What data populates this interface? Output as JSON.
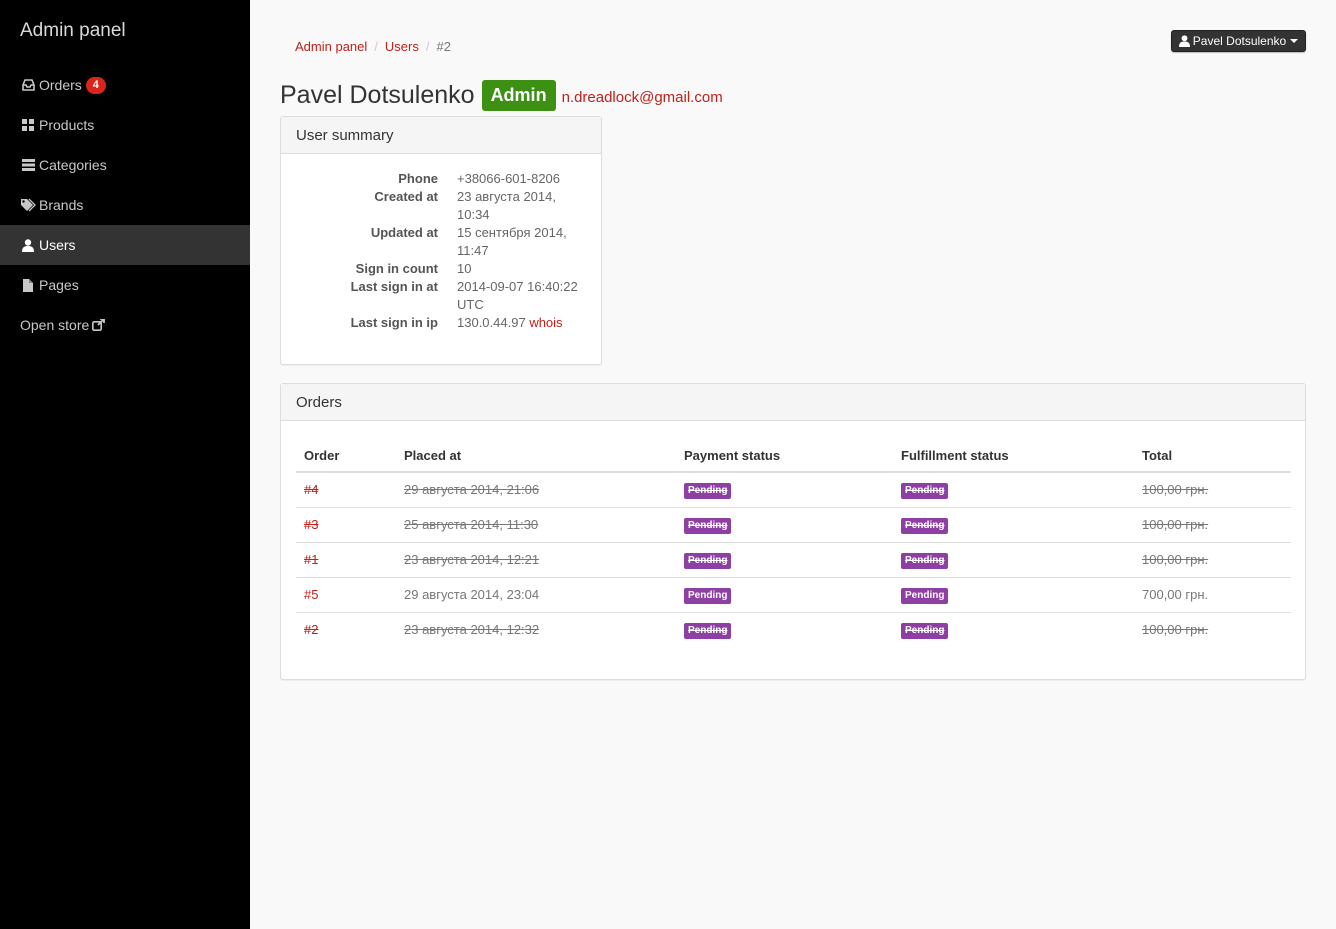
{
  "sidebar": {
    "brand": "Admin panel",
    "items": [
      {
        "label": "Orders",
        "icon": "inbox-icon",
        "badge": "4"
      },
      {
        "label": "Products",
        "icon": "grid-icon"
      },
      {
        "label": "Categories",
        "icon": "list-icon"
      },
      {
        "label": "Brands",
        "icon": "tags-icon"
      },
      {
        "label": "Users",
        "icon": "user-icon",
        "active": true
      },
      {
        "label": "Pages",
        "icon": "file-icon"
      },
      {
        "label": "Open store",
        "icon": "external-link-icon"
      }
    ]
  },
  "breadcrumb": {
    "items": [
      "Admin panel",
      "Users",
      "#2"
    ],
    "separator": "/"
  },
  "user_menu": {
    "label": "Pavel Dotsulenko",
    "icon": "user-icon"
  },
  "user": {
    "name": "Pavel Dotsulenko",
    "role": "Admin",
    "email": "n.dreadlock@gmail.com"
  },
  "summary": {
    "title": "User summary",
    "fields": [
      {
        "label": "Phone",
        "value": "+38066-601-8206"
      },
      {
        "label": "Created at",
        "value": "23 августа 2014, 10:34"
      },
      {
        "label": "Updated at",
        "value": "15 сентября 2014, 11:47"
      },
      {
        "label": "Sign in count",
        "value": "10"
      },
      {
        "label": "Last sign in at",
        "value": "2014-09-07 16:40:22 UTC"
      },
      {
        "label": "Last sign in ip",
        "value": "130.0.44.97",
        "link": "whois"
      }
    ]
  },
  "orders": {
    "title": "Orders",
    "columns": [
      "Order",
      "Placed at",
      "Payment status",
      "Fulfillment status",
      "Total"
    ],
    "rows": [
      {
        "order": "#4",
        "placed_at": "29 августа 2014, 21:06",
        "payment": "Pending",
        "fulfillment": "Pending",
        "total": "100,00 грн.",
        "struck": true
      },
      {
        "order": "#3",
        "placed_at": "25 августа 2014, 11:30",
        "payment": "Pending",
        "fulfillment": "Pending",
        "total": "100,00 грн.",
        "struck": true
      },
      {
        "order": "#1",
        "placed_at": "23 августа 2014, 12:21",
        "payment": "Pending",
        "fulfillment": "Pending",
        "total": "100,00 грн.",
        "struck": true
      },
      {
        "order": "#5",
        "placed_at": "29 августа 2014, 23:04",
        "payment": "Pending",
        "fulfillment": "Pending",
        "total": "700,00 грн.",
        "struck": false
      },
      {
        "order": "#2",
        "placed_at": "23 августа 2014, 12:32",
        "payment": "Pending",
        "fulfillment": "Pending",
        "total": "100,00 грн.",
        "struck": true
      }
    ]
  },
  "colors": {
    "sidebar_bg": "#000000",
    "active_bg": "#333333",
    "link": "#c0211b",
    "admin_label": "#3d9112",
    "pending_label": "#8e3fa3",
    "badge": "#d9261c"
  }
}
